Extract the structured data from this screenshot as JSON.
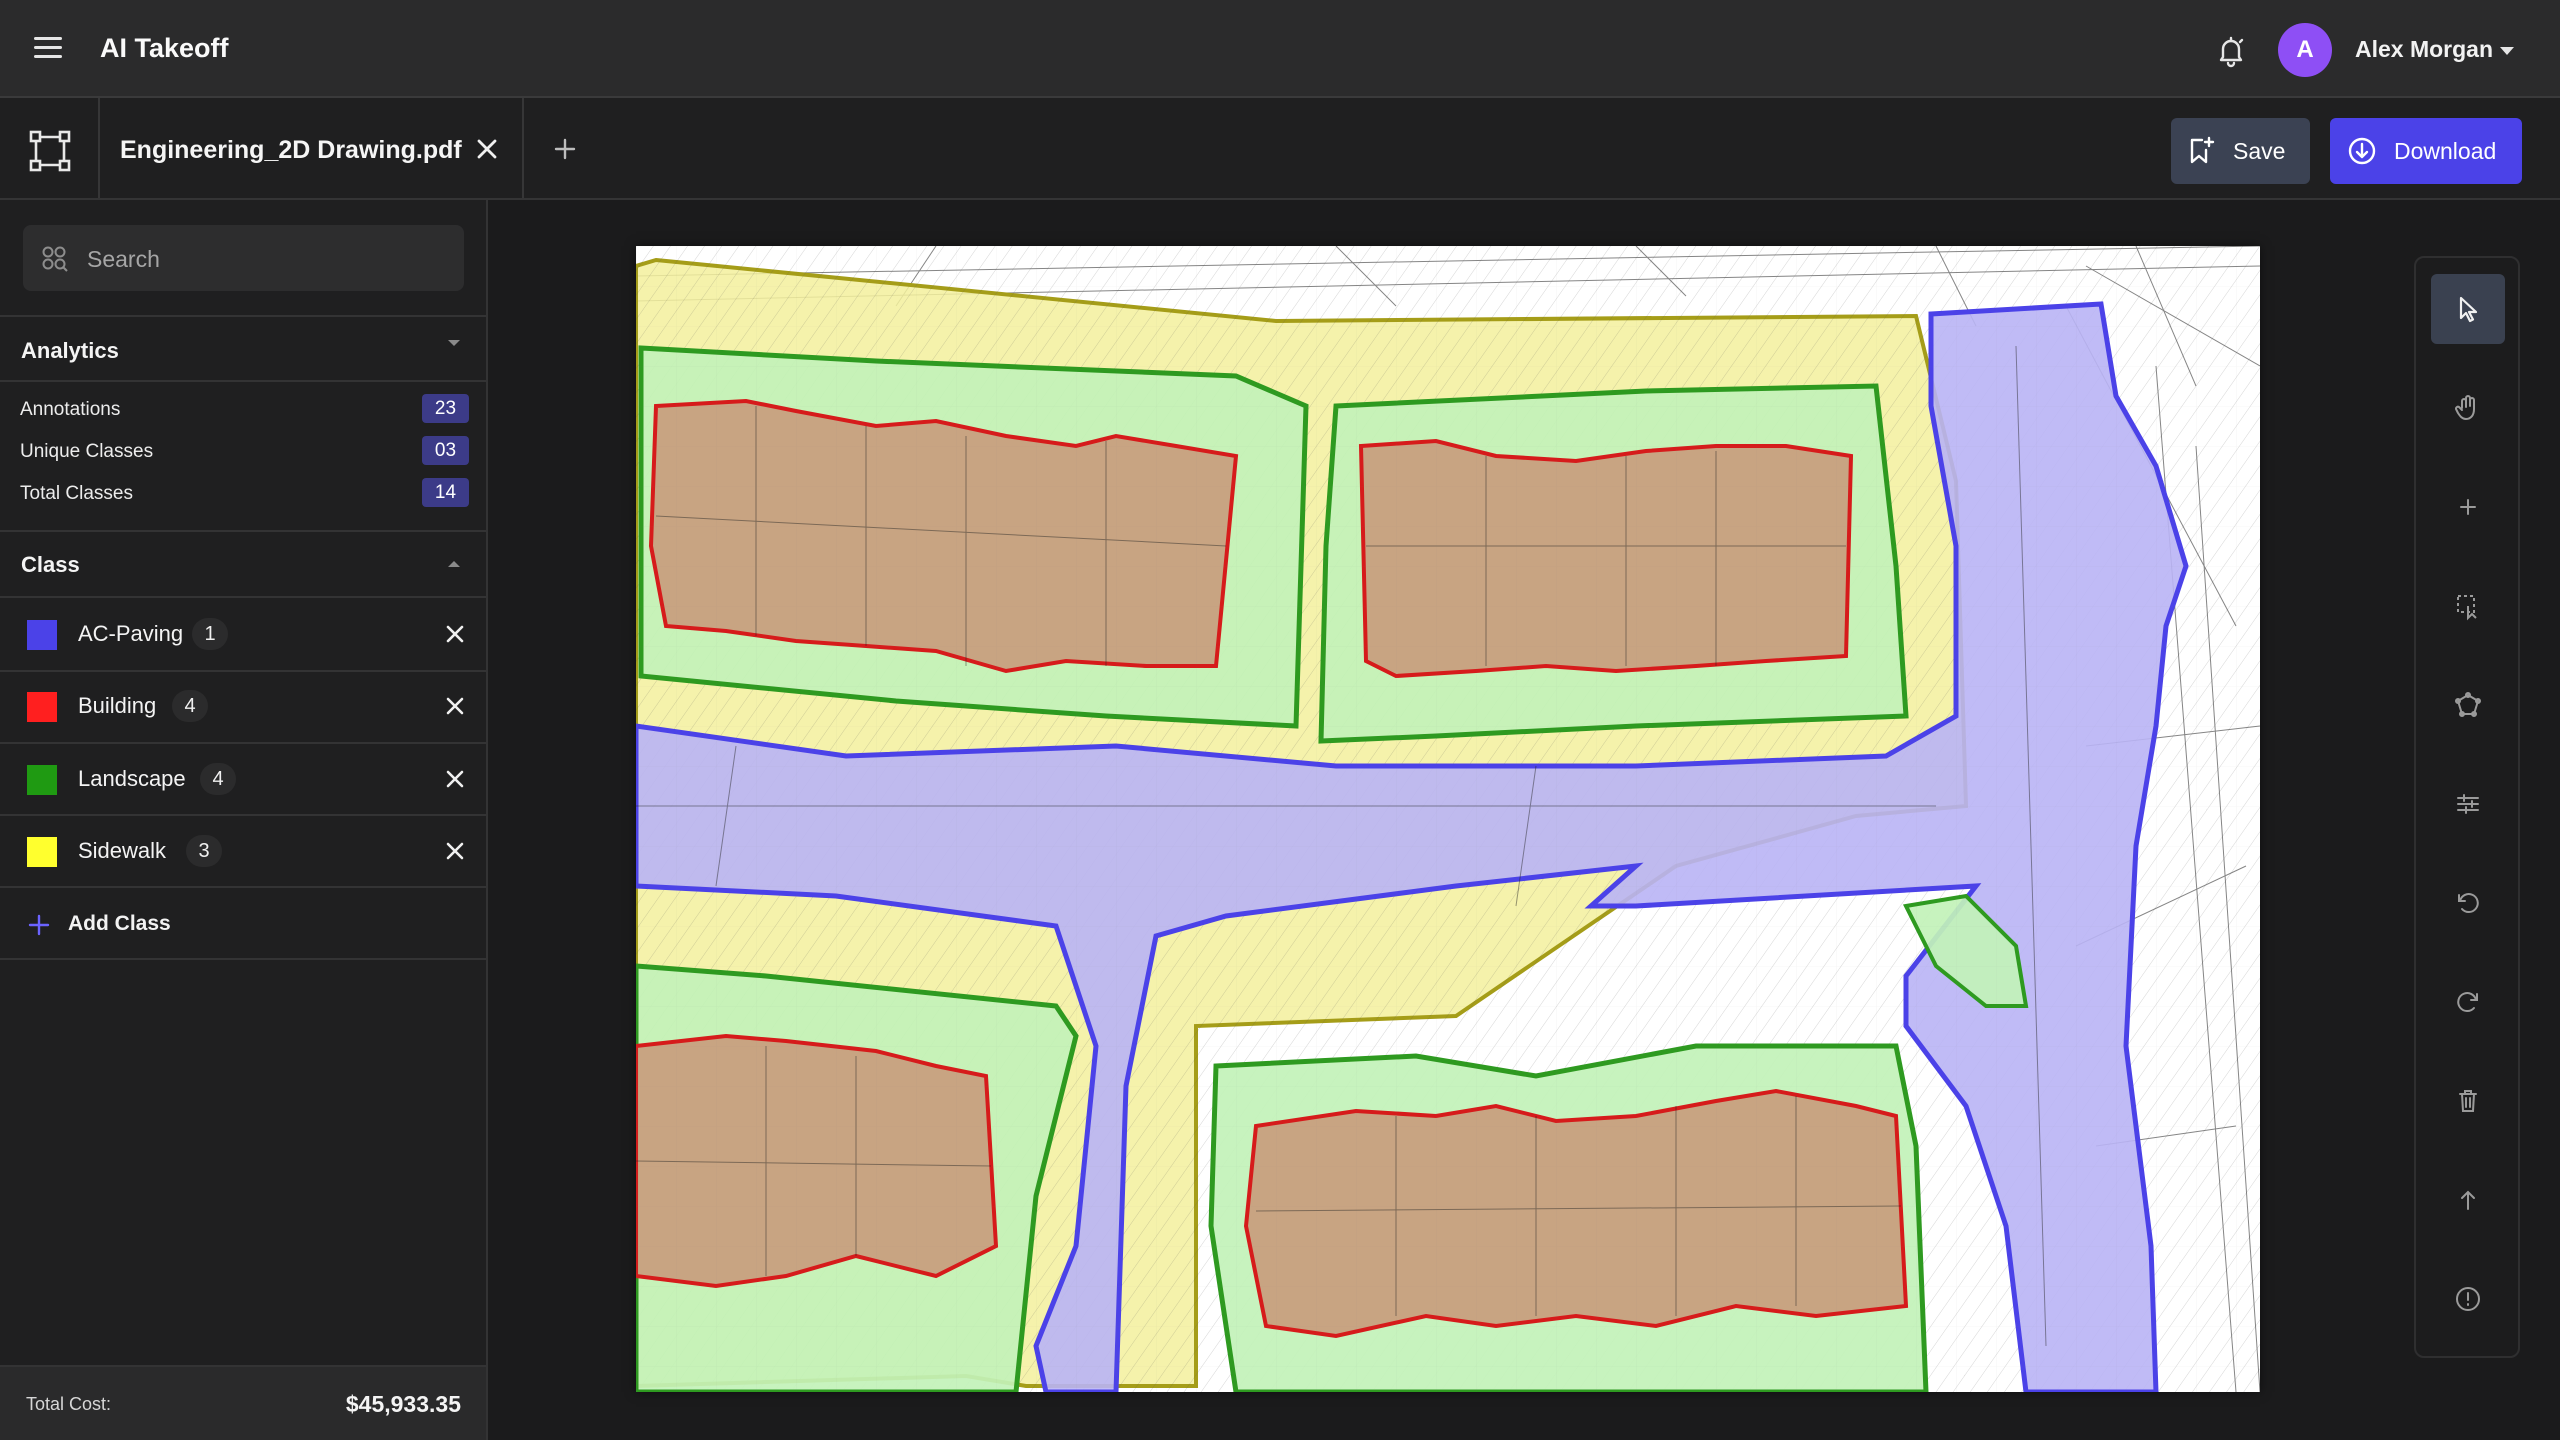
{
  "app": {
    "title": "AI Takeoff"
  },
  "user": {
    "initial": "A",
    "name": "Alex Morgan",
    "avatar_color": "#8e4ff5"
  },
  "document": {
    "tab_label": "Engineering_2D Drawing.pdf"
  },
  "actions": {
    "save_label": "Save",
    "download_label": "Download"
  },
  "search": {
    "placeholder": "Search",
    "value": ""
  },
  "analytics": {
    "title": "Analytics",
    "stats": [
      {
        "label": "Annotations",
        "value": "23"
      },
      {
        "label": "Unique Classes",
        "value": "03"
      },
      {
        "label": "Total Classes",
        "value": "14"
      }
    ]
  },
  "classes": {
    "title": "Class",
    "items": [
      {
        "name": "AC-Paving",
        "count": "1",
        "color": "#4b42e8"
      },
      {
        "name": "Building",
        "count": "4",
        "color": "#ff1f1f"
      },
      {
        "name": "Landscape",
        "count": "4",
        "color": "#1f9a12"
      },
      {
        "name": "Sidewalk",
        "count": "3",
        "color": "#ffff2e"
      }
    ],
    "add_label": "Add Class"
  },
  "footer": {
    "label": "Total Cost:",
    "value": "$45,933.35"
  },
  "tools": [
    "select-icon",
    "pan-icon",
    "add-point-icon",
    "box-select-icon",
    "polygon-icon",
    "adjust-icon",
    "undo-icon",
    "redo-icon",
    "delete-icon",
    "upload-icon",
    "info-icon"
  ],
  "colors": {
    "accent": "#4b42e8",
    "paving_fill": "#b9b4f5",
    "building_fill": "#c89f7e",
    "landscape_fill": "#c2f2b9",
    "sidewalk_fill": "#f3f09c"
  }
}
